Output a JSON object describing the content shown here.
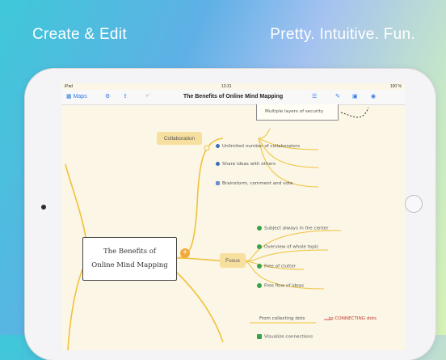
{
  "promo": {
    "left_headline": "Create & Edit",
    "right_headline": "Pretty. Intuitive. Fun."
  },
  "status_bar": {
    "device": "iPad",
    "time": "13:31",
    "battery": "100 %"
  },
  "toolbar": {
    "maps_label": "Maps",
    "document_title": "The Benefits of  Online Mind Mapping"
  },
  "mindmap": {
    "central_line1": "The Benefits of",
    "central_line2": "Online Mind Mapping",
    "popup_text": "Multiple layers of security",
    "collaboration": {
      "label": "Collaboration",
      "children": [
        "Unlimited number of collaborators",
        "Share ideas with others",
        "Brainstorm, comment and vote"
      ]
    },
    "focus": {
      "label": "Focus",
      "children": [
        "Subject always in the center",
        "Overview of whole topic",
        "Free of clutter",
        "Free flow of ideas"
      ]
    },
    "bottom": {
      "from_text": "From collecting dots",
      "to_text": "to CONNECTING dots",
      "visualize_text": "Visualize connections"
    }
  },
  "colors": {
    "branch": "#f0c23a",
    "pill": "#f7dfa0",
    "check_green": "#3aa34a",
    "bullet_blue": "#3a6fb8",
    "plus_orange": "#f2a93b",
    "connector_red": "#d9534f"
  }
}
